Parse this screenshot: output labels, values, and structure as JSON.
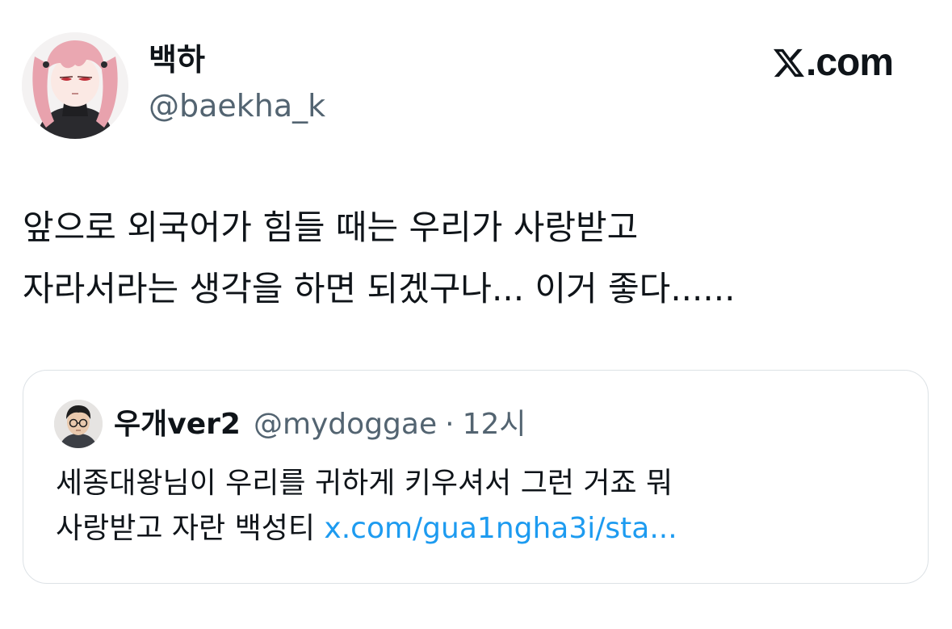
{
  "author": {
    "display_name": "백하",
    "handle": "@baekha_k"
  },
  "brand": {
    "text": ".com",
    "icon": "x-logo-icon"
  },
  "tweet": {
    "lines": [
      "앞으로 외국어가 힘들 때는 우리가 사랑받고",
      "자라서라는 생각을 하면 되겠구나... 이거 좋다......"
    ]
  },
  "quoted_tweet": {
    "display_name": "우개ver2",
    "handle": "@mydoggae",
    "separator": "·",
    "time": "12시",
    "line1": "세종대왕님이 우리를 귀하게 키우셔서 그런 거죠 뭐",
    "line2_text": "사랑받고 자란 백성티",
    "link_text": "x.com/gua1ngha3i/sta..."
  },
  "colors": {
    "text_primary": "#0f1419",
    "text_secondary": "#536471",
    "link": "#1d9bf0",
    "card_border": "#dde2e6"
  }
}
